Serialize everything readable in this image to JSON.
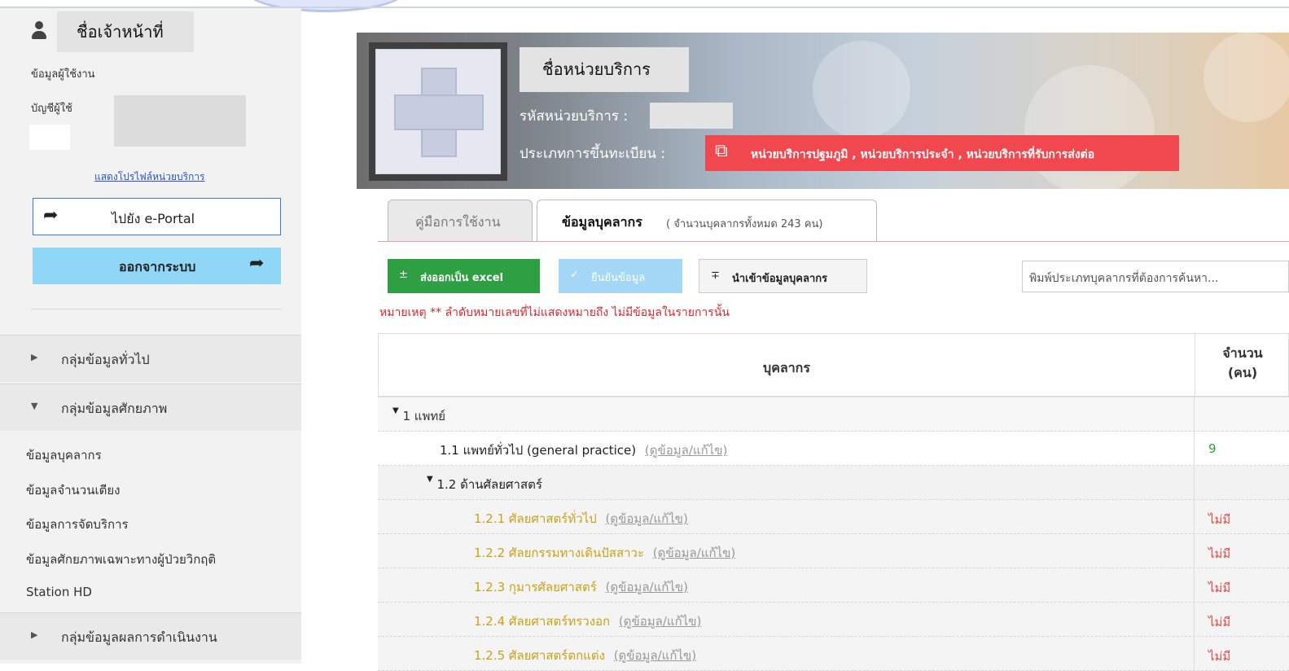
{
  "user": {
    "officer_name": "ชื่อเจ้าหน้าที่",
    "info_label": "ข้อมูลผู้ใช้งาน",
    "account_label": "บัญชีผู้ใช้",
    "profile_link": "แสดงโปรไฟล์หน่วยบริการ"
  },
  "nav": {
    "eportal_label": "ไปยัง e-Portal",
    "logout_label": "ออกจากระบบ"
  },
  "sidebar": {
    "groups": [
      {
        "label": "กลุ่มข้อมูลทั่วไป",
        "expanded": false
      },
      {
        "label": "กลุ่มข้อมูลศักยภาพ",
        "expanded": true
      },
      {
        "label": "กลุ่มข้อมูลผลการดำเนินงาน",
        "expanded": false
      }
    ],
    "items": [
      "ข้อมูลบุคลากร",
      "ข้อมูลจำนวนเตียง",
      "ข้อมูลการจัดบริการ",
      "ข้อมูลศักยภาพเฉพาะทางผู้ป่วยวิกฤติ",
      "Station HD"
    ]
  },
  "unit": {
    "name": "ชื่อหน่วยบริการ",
    "code_label": "รหัสหน่วยบริการ :",
    "reg_type_label": "ประเภทการขึ้นทะเบียน :",
    "reg_types": "หน่วยบริการปฐมภูมิ , หน่วยบริการประจำ , หน่วยบริการที่รับการส่งต่อ"
  },
  "tabs": {
    "manual": "คู่มือการใช้งาน",
    "personnel": "ข้อมูลบุคลากร",
    "personnel_count": "( จำนวนบุคลากรทั้งหมด 243 คน)"
  },
  "toolbar": {
    "export_label": "ส่งออกเป็น excel",
    "confirm_label": "ยืนยันข้อมูล",
    "import_label": "นำเข้าข้อมูลบุคลากร",
    "search_placeholder": "พิมพ์ประเภทบุคลากรที่ต้องการค้นหา..."
  },
  "note": "หมายเหตุ ** ลำดับหมายเลขที่ไม่แสดงหมายถึง ไม่มีข้อมูลในรายการนั้น",
  "table": {
    "col_personnel": "บุคลากร",
    "col_count_1": "จำนวน",
    "col_count_2": "(คน)",
    "edit_link": "(ดูข้อมูล/แก้ไข)",
    "rows": [
      {
        "label": "1 แพทย์",
        "value": ""
      },
      {
        "label": "1.1 แพทย์ทั่วไป (general practice)",
        "value": "9"
      },
      {
        "label": "1.2 ด้านศัลยศาสตร์",
        "value": ""
      },
      {
        "label": "1.2.1 ศัลยศาสตร์ทั่วไป",
        "value": "ไม่มี"
      },
      {
        "label": "1.2.2 ศัลยกรรมทางเดินปัสสาวะ",
        "value": "ไม่มี"
      },
      {
        "label": "1.2.3 กุมารศัลยศาสตร์",
        "value": "ไม่มี"
      },
      {
        "label": "1.2.4 ศัลยศาสตร์ทรวงอก",
        "value": "ไม่มี"
      },
      {
        "label": "1.2.5 ศัลยศาสตร์ตกแต่ง",
        "value": "ไม่มี"
      }
    ]
  },
  "colors": {
    "accent_green": "#2ea043",
    "accent_red": "#f1484f",
    "accent_blue": "#8fd6f7"
  }
}
